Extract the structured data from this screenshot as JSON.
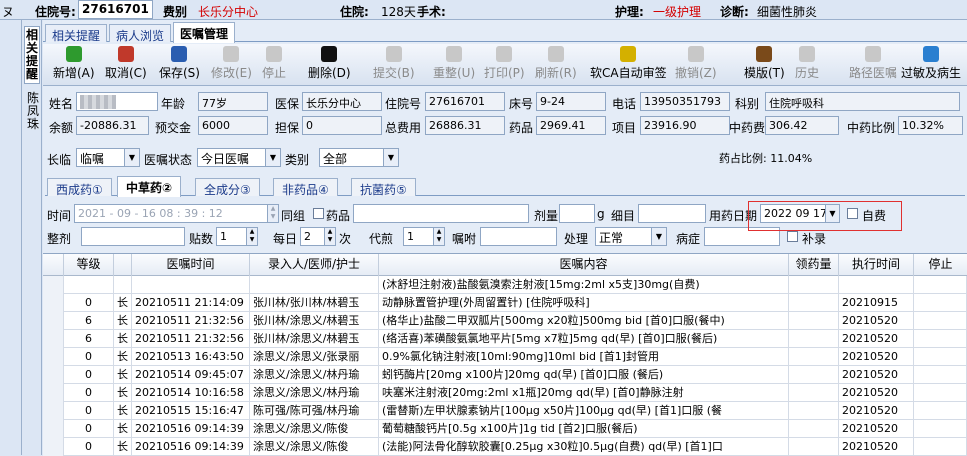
{
  "patient_bar": {
    "arrow_left": "ヌ",
    "inpatient_no_label": "住院号:",
    "inpatient_no": "27616701",
    "fee_type_label": "费别",
    "fee_type": "长乐分中心",
    "stay_label": "住院:",
    "stay_value": "128天",
    "surgery_label": "手术:",
    "nursing_label": "护理:",
    "nursing_value": "一级护理",
    "diagnosis_label": "诊断:",
    "diagnosis_value": "细菌性肺炎"
  },
  "side": {
    "reminder": "相关提醒",
    "doctor": "陈凤珠"
  },
  "top_tabs": [
    "相关提醒",
    "病人浏览",
    "医嘱管理"
  ],
  "toolbar": [
    {
      "label": "新增(A)",
      "icon": "add-icon",
      "color": "#2e9a2e",
      "enabled": true
    },
    {
      "label": "取消(C)",
      "icon": "undo-icon",
      "color": "#c0392b",
      "enabled": true
    },
    {
      "label": "保存(S)",
      "icon": "save-icon",
      "color": "#2a5db0",
      "enabled": true
    },
    {
      "label": "修改(E)",
      "icon": "edit-icon",
      "color": "#888",
      "enabled": false
    },
    {
      "label": "停止",
      "icon": "stop-icon",
      "color": "#888",
      "enabled": false
    },
    {
      "label": "删除(D)",
      "icon": "delete-icon",
      "color": "#111",
      "enabled": true
    },
    {
      "label": "提交(B)",
      "icon": "submit-icon",
      "color": "#888",
      "enabled": false
    },
    {
      "label": "重整(U)",
      "icon": "refresh-icon",
      "color": "#888",
      "enabled": false
    },
    {
      "label": "打印(P)",
      "icon": "print-icon",
      "color": "#888",
      "enabled": false
    },
    {
      "label": "刷新(R)",
      "icon": "reload-icon",
      "color": "#888",
      "enabled": false
    },
    {
      "label": "软CA自动审签",
      "icon": "check-icon",
      "color": "#d4b000",
      "enabled": true
    },
    {
      "label": "撤销(Z)",
      "icon": "trash-icon",
      "color": "#888",
      "enabled": false
    },
    {
      "label": "模版(T)",
      "icon": "book-icon",
      "color": "#7a4a1a",
      "enabled": true
    },
    {
      "label": "历史",
      "icon": "history-icon",
      "color": "#888",
      "enabled": false
    },
    {
      "label": "路径医嘱",
      "icon": "path-icon",
      "color": "#888",
      "enabled": false
    },
    {
      "label": "过敏及病生",
      "icon": "allergy-icon",
      "color": "#2a7fd0",
      "enabled": true
    }
  ],
  "info": {
    "name_label": "姓名",
    "age_label": "年龄",
    "age": "77岁",
    "insurance_label": "医保",
    "insurance": "长乐分中心",
    "inpatient_label": "住院号",
    "inpatient": "27616701",
    "bed_label": "床号",
    "bed": "9-24",
    "phone_label": "电话",
    "phone": "13950351793",
    "dept_label": "科别",
    "dept": "住院呼吸科",
    "balance_label": "余额",
    "balance": "-20886.31",
    "prepay_label": "预交金",
    "prepay": "6000",
    "guarantee_label": "担保",
    "guarantee": "0",
    "total_label": "总费用",
    "total": "26886.31",
    "drug_label": "药品",
    "drug": "2969.41",
    "item_label": "项目",
    "item": "23916.90",
    "herb_fee_label": "中药费",
    "herb_fee": "306.42",
    "herb_ratio_label": "中药比例",
    "herb_ratio": "10.32%"
  },
  "filter": {
    "type_label": "长临",
    "type": "临嘱",
    "status_label": "医嘱状态",
    "status": "今日医嘱",
    "category_label": "类别",
    "category": "全部",
    "drug_ratio": "药占比例: 11.04%"
  },
  "sub_tabs": [
    "西成药①",
    "中草药②",
    "全成分③",
    "非药品④",
    "抗菌药⑤"
  ],
  "form": {
    "time_label": "时间",
    "time_value": "2021 - 09 - 16    08 : 39 : 12",
    "same_group_label": "同组",
    "drug_label": "药品",
    "dose_label": "剂量",
    "dose_unit": "g",
    "detail_label": "细目",
    "date_label": "用药日期",
    "date_value": "2022 09 17",
    "self_pay_label": "自费",
    "whole_label": "整剂",
    "count_label": "贴数",
    "count": "1",
    "daily_label": "每日",
    "daily": "2",
    "times_label": "次",
    "decoct_label": "代煎",
    "decoct": "1",
    "note_label": "嘱咐",
    "process_label": "处理",
    "process": "正常",
    "disease_label": "病症",
    "refill_label": "补录"
  },
  "grid": {
    "headers": [
      "",
      "等级",
      "",
      "医嘱时间",
      "录入人/医师/护士",
      "医嘱内容",
      "领药量",
      "执行时间",
      "停止"
    ],
    "rows": [
      {
        "level": "",
        "type": "",
        "time": "",
        "person": "",
        "content": "(沐舒坦注射液)盐酸氨溴索注射液[15mg:2ml x5支]30mg(自费)",
        "qty": "",
        "exec": ""
      },
      {
        "level": "0",
        "type": "长",
        "time": "20210511 21:14:09",
        "person": "张川林/张川林/林碧玉",
        "content": "动静脉置管护理(外周留置针)    [住院呼吸科]",
        "qty": "",
        "exec": "20210915"
      },
      {
        "level": "6",
        "type": "长",
        "time": "20210511 21:32:56",
        "person": "张川林/涂思义/林碧玉",
        "content": "(格华止)盐酸二甲双胍片[500mg x20粒]500mg  bid  [首0]口服(餐中)",
        "qty": "",
        "exec": "20210520"
      },
      {
        "level": "6",
        "type": "长",
        "time": "20210511 21:32:56",
        "person": "张川林/涂思义/林碧玉",
        "content": "(络活喜)苯磺酸氨氯地平片[5mg x7粒]5mg  qd(早) [首0]口服(餐后)",
        "qty": "",
        "exec": "20210520"
      },
      {
        "level": "0",
        "type": "长",
        "time": "20210513 16:43:50",
        "person": "涂思义/涂思义/张录丽",
        "content": "0.9%氯化钠注射液[10ml:90mg]10ml  bid [首1]封管用",
        "qty": "",
        "exec": "20210520"
      },
      {
        "level": "0",
        "type": "长",
        "time": "20210514 09:45:07",
        "person": "涂思义/涂思义/林丹瑜",
        "content": "蚓钙酶片[20mg x100片]20mg  qd(早) [首0]口服 (餐后)",
        "qty": "",
        "exec": "20210520"
      },
      {
        "level": "0",
        "type": "长",
        "time": "20210514 10:16:58",
        "person": "涂思义/涂思义/林丹瑜",
        "content": "呋塞米注射液[20mg:2ml x1瓶]20mg  qd(早) [首0]静脉注射",
        "qty": "",
        "exec": "20210520"
      },
      {
        "level": "0",
        "type": "长",
        "time": "20210515 15:16:47",
        "person": "陈可强/陈可强/林丹瑜",
        "content": "(雷替斯)左甲状腺素钠片[100μg x50片]100μg  qd(早) [首1]口服 (餐",
        "qty": "",
        "exec": "20210520"
      },
      {
        "level": "0",
        "type": "长",
        "time": "20210516 09:14:39",
        "person": "涂思义/涂思义/陈俊",
        "content": "葡萄糖酸钙片[0.5g x100片]1g  tid [首2]口服(餐后)",
        "qty": "",
        "exec": "20210520"
      },
      {
        "level": "0",
        "type": "长",
        "time": "20210516 09:14:39",
        "person": "涂思义/涂思义/陈俊",
        "content": "(法能)阿法骨化醇软胶囊[0.25μg x30粒]0.5μg(自费)  qd(早) [首1]口",
        "qty": "",
        "exec": "20210520"
      }
    ]
  }
}
